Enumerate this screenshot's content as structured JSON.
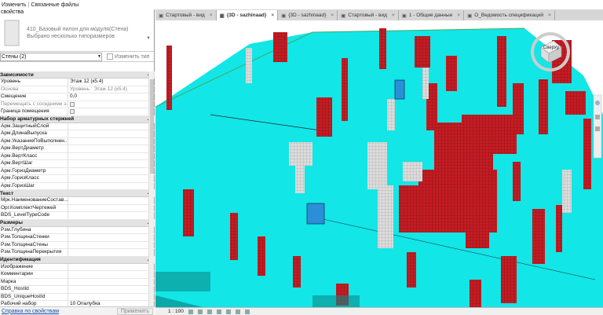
{
  "topbar": {
    "modify": "Изменить",
    "linked_files": "Связанные файлы"
  },
  "properties": {
    "header": "свойства",
    "type_name": "410_Базовый пилон для модуля(Стена)",
    "type_sub": "Выбрано несколько типоразмеров",
    "instance_filter": "Стены (2)",
    "edit_type": "Изменить тип",
    "groups": [
      {
        "title": "Зависимости",
        "rows": [
          {
            "k": "Уровень",
            "v": "Этаж 12 (к5.4)"
          },
          {
            "k": "Основа",
            "v": "Уровень : Этаж 12 (к5.4)",
            "dim": true
          },
          {
            "k": "Смещение",
            "v": "0,0"
          },
          {
            "k": "Перемещать с соседними э...",
            "v": "",
            "dim": true,
            "check": true
          },
          {
            "k": "Граница помещения",
            "v": "",
            "check": true
          }
        ]
      },
      {
        "title": "Набор арматурных стержней",
        "rows": [
          {
            "k": "Арм.ЗащитныйСлой",
            "v": ""
          },
          {
            "k": "Арм.ДлинаВыпуска",
            "v": ""
          },
          {
            "k": "Арм.УказаниеПоВыполнен...",
            "v": ""
          },
          {
            "k": "Арм.ВертДиаметр",
            "v": ""
          },
          {
            "k": "Арм.ВертКласс",
            "v": ""
          },
          {
            "k": "Арм.ВертШаг",
            "v": ""
          },
          {
            "k": "Арм.ГоризДиаметр",
            "v": ""
          },
          {
            "k": "Арм.ГоризКласс",
            "v": ""
          },
          {
            "k": "Арм.ГоризШаг",
            "v": ""
          }
        ]
      },
      {
        "title": "Текст",
        "rows": [
          {
            "k": "Мрк.НаименованиеСостав...",
            "v": ""
          },
          {
            "k": "Орг.КомплектЧертежей",
            "v": ""
          },
          {
            "k": "BDS_LevelTypeCode",
            "v": ""
          }
        ]
      },
      {
        "title": "Размеры",
        "rows": [
          {
            "k": "Рзм.Глубина",
            "v": ""
          },
          {
            "k": "Рзм.ТолщинаСтенки",
            "v": ""
          },
          {
            "k": "Рзм.ТолщинаСтены",
            "v": ""
          },
          {
            "k": "Рзм.ТолщинаПерекрытия",
            "v": ""
          }
        ]
      },
      {
        "title": "Идентификация",
        "rows": [
          {
            "k": "Изображение",
            "v": ""
          },
          {
            "k": "Комментарии",
            "v": ""
          },
          {
            "k": "Марка",
            "v": ""
          },
          {
            "k": "BDS_HostId",
            "v": ""
          },
          {
            "k": "BDS_UniqueHostId",
            "v": ""
          },
          {
            "k": "Рабочий набор",
            "v": "10 Опалубка"
          }
        ]
      }
    ],
    "help_link": "Справка по свойствам",
    "apply": "Применить"
  },
  "tabs": [
    {
      "label": "Стартовый - вид",
      "active": false
    },
    {
      "label": "{3D - sazhinaad}",
      "active": true
    },
    {
      "label": "{3D - sazhinaad}",
      "active": false
    },
    {
      "label": "Стартовый - вид",
      "active": false
    },
    {
      "label": "1 - Общие данные",
      "active": false
    },
    {
      "label": "О_Ведомость спецификаций",
      "active": false
    }
  ],
  "viewcube": {
    "label": "Сверху"
  },
  "status": {
    "scale": "1 : 100"
  },
  "colors": {
    "floor": "#12e6e6",
    "wall_red": "#c41d24",
    "selected": "#2a8fd6"
  }
}
